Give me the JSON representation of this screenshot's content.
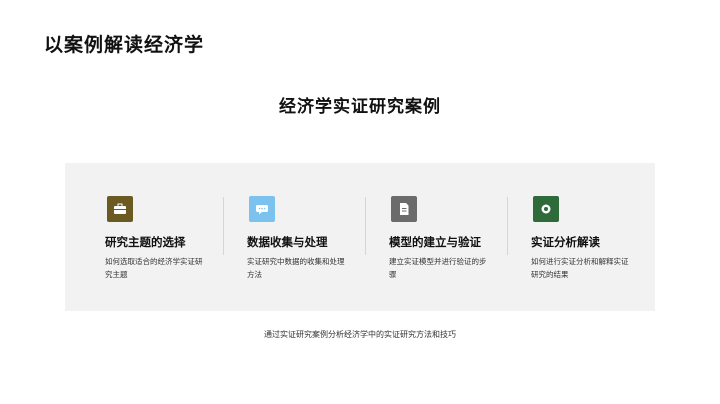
{
  "slide": {
    "title": "以案例解读经济学",
    "section_title": "经济学实证研究案例",
    "footer": "通过实证研究案例分析经济学中的实证研究方法和技巧"
  },
  "cards": [
    {
      "title": "研究主题的选择",
      "description": "如何选取适合的经济学实证研究主题",
      "icon": "briefcase-icon",
      "icon_color": "#6b5a22"
    },
    {
      "title": "数据收集与处理",
      "description": "实证研究中数据的收集和处理方法",
      "icon": "chat-bubble-icon",
      "icon_color": "#7cc2ee"
    },
    {
      "title": "模型的建立与验证",
      "description": "建立实证模型并进行验证的步骤",
      "icon": "document-icon",
      "icon_color": "#6b6b6b"
    },
    {
      "title": "实证分析解读",
      "description": "如何进行实证分析和解释实证研究的结果",
      "icon": "target-icon",
      "icon_color": "#2f6a3a"
    }
  ]
}
